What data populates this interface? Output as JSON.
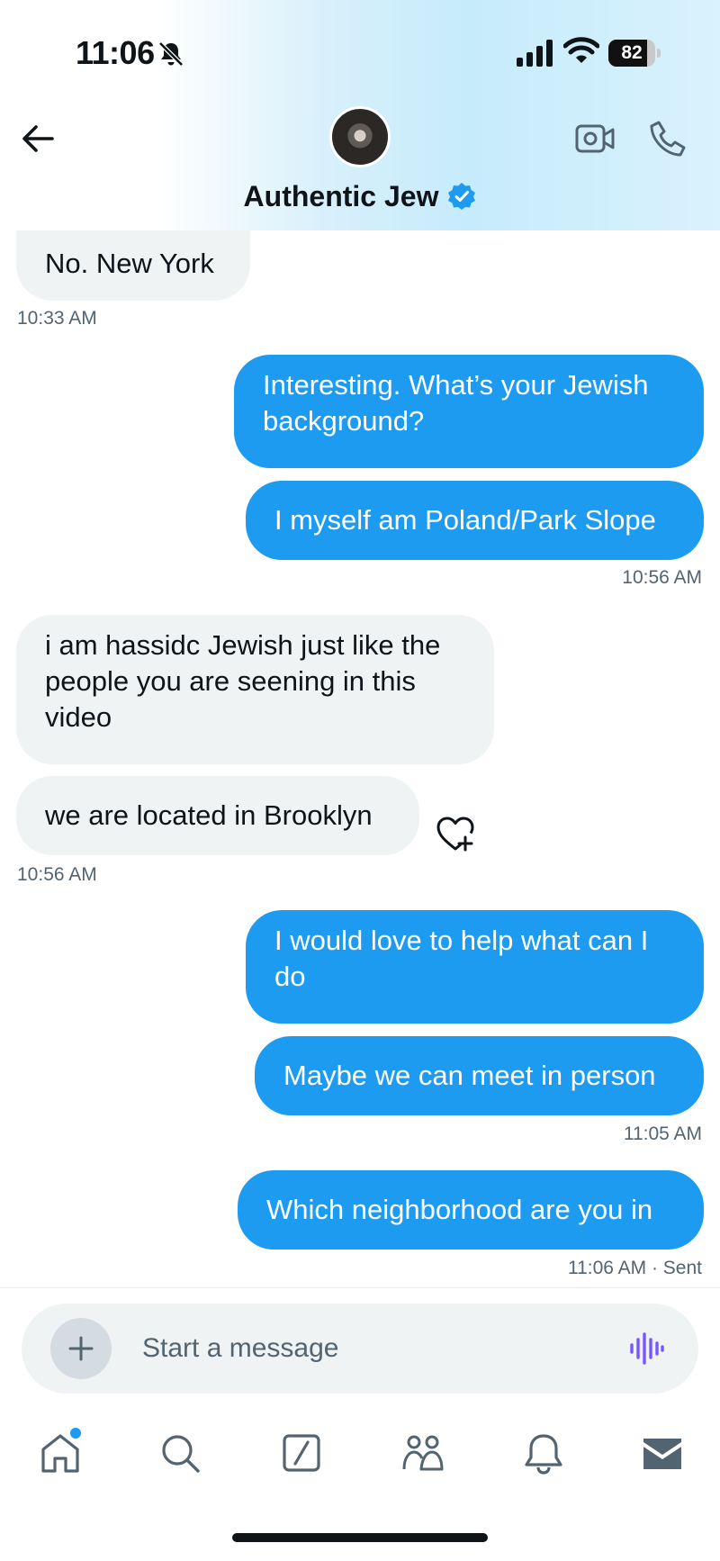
{
  "status_bar": {
    "time": "11:06",
    "battery_level": "82",
    "battery_fraction": 0.82
  },
  "header": {
    "contact_name": "Authentic Jew",
    "verified": true
  },
  "messages": [
    {
      "text": "No. New York",
      "direction": "received"
    },
    {
      "text": "10:33 AM"
    },
    {
      "text": "Interesting. What’s your Jewish background?",
      "direction": "sent"
    },
    {
      "text": "I myself am Poland/Park Slope",
      "direction": "sent"
    },
    {
      "text": "10:56 AM"
    },
    {
      "text": "i am hassidc Jewish just like the people you are seening in this video",
      "direction": "received"
    },
    {
      "text": "we are located in Brooklyn",
      "direction": "received"
    },
    {
      "text": "10:56 AM"
    },
    {
      "text": "I would love to help what can I do",
      "direction": "sent"
    },
    {
      "text": "Maybe we can meet in person",
      "direction": "sent"
    },
    {
      "text": "11:05 AM"
    },
    {
      "text": "Which neighborhood are you in",
      "direction": "sent"
    },
    {
      "text": "11:06 AM · Sent"
    }
  ],
  "composer": {
    "placeholder": "Start a message"
  },
  "bottom_nav": [
    "home-icon",
    "search-icon",
    "grok-icon",
    "communities-icon",
    "notifications-icon",
    "messages-icon"
  ],
  "colors": {
    "accent": "#1d9bf0",
    "received_bubble": "#eff3f4",
    "secondary_text": "#536471",
    "voice_accent": "#7856ff"
  }
}
